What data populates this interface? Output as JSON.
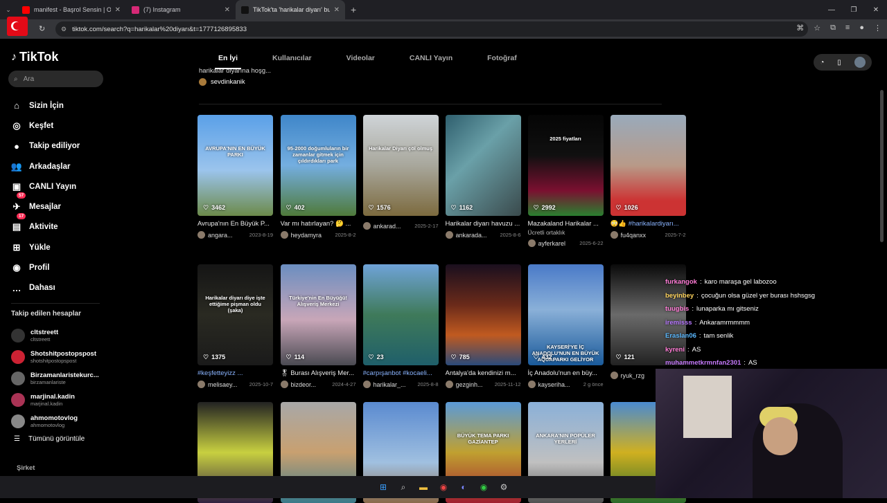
{
  "browser": {
    "tabs": [
      {
        "title": "manifest - Başrol Sensin | Offici",
        "color": "#ff0000"
      },
      {
        "title": "(7) Instagram",
        "color": "#d62976"
      },
      {
        "title": "TikTok'ta 'harikalar diyarı' bulab",
        "color": "#111111"
      }
    ],
    "url": "tiktok.com/search?q=harikalar%20diyarı&t=1777126895833"
  },
  "sidebar": {
    "logo": "TikTok",
    "search_placeholder": "Ara",
    "nav": [
      {
        "label": "Sizin İçin",
        "icon": "⌂"
      },
      {
        "label": "Keşfet",
        "icon": "◎"
      },
      {
        "label": "Takip ediliyor",
        "icon": "●"
      },
      {
        "label": "Arkadaşlar",
        "icon": "👥"
      },
      {
        "label": "CANLI Yayın",
        "icon": "▣"
      },
      {
        "label": "Mesajlar",
        "icon": "✈",
        "badge": "57"
      },
      {
        "label": "Aktivite",
        "icon": "▤",
        "badge": "17"
      },
      {
        "label": "Yükle",
        "icon": "⊞"
      },
      {
        "label": "Profil",
        "icon": "◉"
      },
      {
        "label": "Dahası",
        "icon": "…"
      }
    ],
    "following_title": "Takip edilen hesaplar",
    "following": [
      {
        "name": "cltstreett",
        "handle": "cltstreett",
        "color": "#333"
      },
      {
        "name": "Shotshitpostopspost",
        "handle": "shotshitpostopspost",
        "color": "#c23"
      },
      {
        "name": "Birzamanlaristekurc...",
        "handle": "birzamanlariste",
        "color": "#666"
      },
      {
        "name": "marjinal.kadin",
        "handle": "marjinal.kadin",
        "color": "#a35"
      },
      {
        "name": "ahmomotovlog",
        "handle": "ahmomotovlog",
        "color": "#888"
      }
    ],
    "see_all": "Tümünü görüntüle",
    "company": "Şirket"
  },
  "main": {
    "tabs": [
      "En İyi",
      "Kullanıcılar",
      "Videolar",
      "CANLI Yayın",
      "Fotoğraf"
    ],
    "prev_caption": "harikalar diyarına hoşg...",
    "prev_user": "sevdinkanik",
    "rows": [
      [
        {
          "likes": "3462",
          "caption": "Avrupa'nın En Büyük P...",
          "user": "angara...",
          "date": "2023-8-19",
          "overlay": "AVRUPA'NIN EN BÜYÜK PARKI",
          "bg": "linear-gradient(#5aa0e8,#9bc4ec 55%,#6c8a4a)"
        },
        {
          "likes": "402",
          "caption": "Var mı hatırlayan? 🤔 ...",
          "user": "heydamyra",
          "date": "2025-8-2",
          "overlay": "95-2000 doğumluların bir zamanlar gitmek için çıldırdıkları park",
          "bg": "linear-gradient(#3f86c9,#74aee0 50%,#4f7a3a)"
        },
        {
          "likes": "1576",
          "caption": "",
          "user": "ankarad...",
          "date": "2025-2-17",
          "overlay": "Harikalar Diyarı çöl olmuş",
          "bg": "linear-gradient(#cfd4d8,#a8a79c 50%,#7c6a3e)"
        },
        {
          "likes": "1162",
          "caption": "Harikalar diyarı havuzu ...",
          "user": "ankarada...",
          "date": "2025-8-6",
          "overlay": "",
          "bg": "linear-gradient(135deg,#2f5f6e,#6aa0a8 40%,#3a4a4c)"
        },
        {
          "likes": "2992",
          "caption": "Mazakaland Harikalar ...",
          "user": "ayferkarel",
          "date": "2025-6-22",
          "overlay": "2025 fiyatları",
          "tag": "Ücretli ortaklık",
          "bg": "linear-gradient(#050505,#101010 40%,#7a1030 75%,#2a8030)"
        },
        {
          "likes": "1026",
          "caption": "😳👍 #harikalardiyarı...",
          "user": "fu4qanxx",
          "date": "2025-7-2",
          "overlay": "",
          "hash": true,
          "bg": "linear-gradient(#9ab,#b89a88 50%,#c33 85%)"
        }
      ],
      [
        {
          "likes": "1375",
          "caption": "#keşfetteyizz ...",
          "user": "melisaey...",
          "date": "2025-10-7",
          "overlay": "Harikalar diyarı diye işte ettiğime pişman oldu (şaka)",
          "hash": true,
          "bg": "linear-gradient(#151515,#2a2a22 50%,#1a1a1a)"
        },
        {
          "likes": "114",
          "caption": "🎖 Burası Alışveriş Mer...",
          "user": "bizdeor...",
          "date": "2024-4-27",
          "overlay": "Türkiye'nin En Büyüğü! Alışveriş Merkezi",
          "bg": "linear-gradient(#6b8ec0,#c8a6b8 55%,#4a4a52)"
        },
        {
          "likes": "23",
          "caption": "#carpışanbot #kocaeli...",
          "user": "harikalar_...",
          "date": "2025-8-8",
          "overlay": "",
          "hash": true,
          "bg": "linear-gradient(#6fa3d8,#3f7a5a 50%,#1f5f6a)"
        },
        {
          "likes": "785",
          "caption": "Antalya'da kendinizi m...",
          "user": "gezginh...",
          "date": "2025-11-12",
          "overlay": "",
          "bg": "linear-gradient(#1a0f1e,#6a2a1a 40%,#c05a20 70%,#2a4a7a)"
        },
        {
          "likes": "432",
          "caption": "İç Anadolu'nun en büy...",
          "user": "kayseriha...",
          "date": "2 g önce",
          "overlay": "KAYSERİ'YE İÇ ANADOLU'NUN EN BÜYÜK AQUAPARKI GELİYOR",
          "bg": "linear-gradient(#4a7ac8,#8ab0d8 45%,#1a5a9a)"
        },
        {
          "likes": "121",
          "caption": "",
          "user": "ryuk_rzg",
          "date": "",
          "overlay": "",
          "bg": "linear-gradient(#0a0a0a,#6a6a6a 50%,#222)"
        }
      ],
      [
        {
          "likes": "",
          "caption": "",
          "user": "",
          "date": "",
          "overlay": "",
          "bg": "linear-gradient(#222,#c8d040 50%,#302040)"
        },
        {
          "likes": "",
          "caption": "",
          "user": "",
          "date": "",
          "overlay": "",
          "bg": "linear-gradient(#a8a8a8,#c8a070 50%,#3a7a8a)"
        },
        {
          "likes": "",
          "caption": "",
          "user": "",
          "date": "",
          "overlay": "",
          "bg": "linear-gradient(#5a8ad0,#a0c0e0 60%,#8a6a4a)"
        },
        {
          "likes": "",
          "caption": "",
          "user": "",
          "date": "",
          "overlay": "BÜYÜK TEMA PARKI GAZİANTEP",
          "bg": "linear-gradient(#5a9ad8,#c0a030 50%,#a02030)"
        },
        {
          "likes": "",
          "caption": "",
          "user": "",
          "date": "",
          "overlay": "ANKARA'NIN POPÜLER YERLERİ",
          "bg": "linear-gradient(#8ab0d8,#c0c0c0 60%,#505050)"
        },
        {
          "likes": "",
          "caption": "",
          "user": "",
          "date": "",
          "overlay": "",
          "bg": "linear-gradient(#4a8ad0,#d0b020 50%,#2a6a2a)"
        }
      ]
    ]
  },
  "chat": [
    {
      "user": "furkangok",
      "text": "karo maraşa gel labozoo",
      "color": "#ff7bd5"
    },
    {
      "user": "beyinbey",
      "text": "çocuğun olsa güzel yer burası hshsgsg",
      "color": "#ffd35c"
    },
    {
      "user": "tuugbis",
      "text": "lunaparka mı gitseniz",
      "color": "#ff7bd5"
    },
    {
      "user": "iremisss",
      "text": "Ankaramrmmmm",
      "color": "#b777ff"
    },
    {
      "user": "Eraslan06",
      "text": "tam senlik",
      "color": "#5ab8ff"
    },
    {
      "user": "kyreni",
      "text": "AS",
      "color": "#ff7bd5"
    },
    {
      "user": "muhammetkrmnfan2301",
      "text": "AS",
      "color": "#c87bff"
    }
  ]
}
